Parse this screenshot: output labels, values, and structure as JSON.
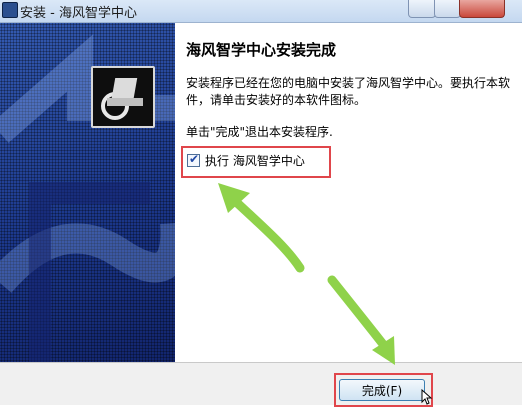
{
  "window": {
    "title": "安装 - 海风智学中心"
  },
  "installer": {
    "heading": "海风智学中心安装完成",
    "description": "安装程序已经在您的电脑中安装了海风智学中心。要执行本软件，请单击安装好的本软件图标。",
    "hint": "单击\"完成\"退出本安装程序.",
    "run_checkbox_label": "执行 海风智学中心",
    "run_checkbox_checked": true,
    "finish_label": "完成(F)"
  },
  "colors": {
    "banner_blue": "#1f3f9e",
    "highlight_red": "#e0464b",
    "annotation_green": "#8fd24a"
  },
  "icons": [
    "app-logo-icon",
    "window-icon",
    "checkbox-tick-icon",
    "mouse-cursor-icon",
    "annotation-arrow-icon"
  ]
}
